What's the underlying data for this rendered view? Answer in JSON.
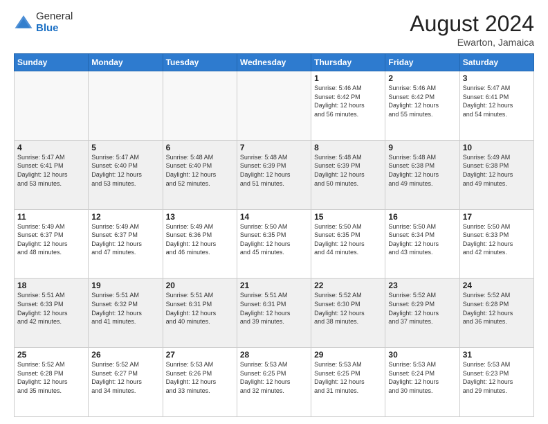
{
  "header": {
    "logo": {
      "general": "General",
      "blue": "Blue"
    },
    "month": "August 2024",
    "location": "Ewarton, Jamaica"
  },
  "weekdays": [
    "Sunday",
    "Monday",
    "Tuesday",
    "Wednesday",
    "Thursday",
    "Friday",
    "Saturday"
  ],
  "weeks": [
    [
      {
        "day": "",
        "info": ""
      },
      {
        "day": "",
        "info": ""
      },
      {
        "day": "",
        "info": ""
      },
      {
        "day": "",
        "info": ""
      },
      {
        "day": "1",
        "info": "Sunrise: 5:46 AM\nSunset: 6:42 PM\nDaylight: 12 hours\nand 56 minutes."
      },
      {
        "day": "2",
        "info": "Sunrise: 5:46 AM\nSunset: 6:42 PM\nDaylight: 12 hours\nand 55 minutes."
      },
      {
        "day": "3",
        "info": "Sunrise: 5:47 AM\nSunset: 6:41 PM\nDaylight: 12 hours\nand 54 minutes."
      }
    ],
    [
      {
        "day": "4",
        "info": "Sunrise: 5:47 AM\nSunset: 6:41 PM\nDaylight: 12 hours\nand 53 minutes."
      },
      {
        "day": "5",
        "info": "Sunrise: 5:47 AM\nSunset: 6:40 PM\nDaylight: 12 hours\nand 53 minutes."
      },
      {
        "day": "6",
        "info": "Sunrise: 5:48 AM\nSunset: 6:40 PM\nDaylight: 12 hours\nand 52 minutes."
      },
      {
        "day": "7",
        "info": "Sunrise: 5:48 AM\nSunset: 6:39 PM\nDaylight: 12 hours\nand 51 minutes."
      },
      {
        "day": "8",
        "info": "Sunrise: 5:48 AM\nSunset: 6:39 PM\nDaylight: 12 hours\nand 50 minutes."
      },
      {
        "day": "9",
        "info": "Sunrise: 5:48 AM\nSunset: 6:38 PM\nDaylight: 12 hours\nand 49 minutes."
      },
      {
        "day": "10",
        "info": "Sunrise: 5:49 AM\nSunset: 6:38 PM\nDaylight: 12 hours\nand 49 minutes."
      }
    ],
    [
      {
        "day": "11",
        "info": "Sunrise: 5:49 AM\nSunset: 6:37 PM\nDaylight: 12 hours\nand 48 minutes."
      },
      {
        "day": "12",
        "info": "Sunrise: 5:49 AM\nSunset: 6:37 PM\nDaylight: 12 hours\nand 47 minutes."
      },
      {
        "day": "13",
        "info": "Sunrise: 5:49 AM\nSunset: 6:36 PM\nDaylight: 12 hours\nand 46 minutes."
      },
      {
        "day": "14",
        "info": "Sunrise: 5:50 AM\nSunset: 6:35 PM\nDaylight: 12 hours\nand 45 minutes."
      },
      {
        "day": "15",
        "info": "Sunrise: 5:50 AM\nSunset: 6:35 PM\nDaylight: 12 hours\nand 44 minutes."
      },
      {
        "day": "16",
        "info": "Sunrise: 5:50 AM\nSunset: 6:34 PM\nDaylight: 12 hours\nand 43 minutes."
      },
      {
        "day": "17",
        "info": "Sunrise: 5:50 AM\nSunset: 6:33 PM\nDaylight: 12 hours\nand 42 minutes."
      }
    ],
    [
      {
        "day": "18",
        "info": "Sunrise: 5:51 AM\nSunset: 6:33 PM\nDaylight: 12 hours\nand 42 minutes."
      },
      {
        "day": "19",
        "info": "Sunrise: 5:51 AM\nSunset: 6:32 PM\nDaylight: 12 hours\nand 41 minutes."
      },
      {
        "day": "20",
        "info": "Sunrise: 5:51 AM\nSunset: 6:31 PM\nDaylight: 12 hours\nand 40 minutes."
      },
      {
        "day": "21",
        "info": "Sunrise: 5:51 AM\nSunset: 6:31 PM\nDaylight: 12 hours\nand 39 minutes."
      },
      {
        "day": "22",
        "info": "Sunrise: 5:52 AM\nSunset: 6:30 PM\nDaylight: 12 hours\nand 38 minutes."
      },
      {
        "day": "23",
        "info": "Sunrise: 5:52 AM\nSunset: 6:29 PM\nDaylight: 12 hours\nand 37 minutes."
      },
      {
        "day": "24",
        "info": "Sunrise: 5:52 AM\nSunset: 6:28 PM\nDaylight: 12 hours\nand 36 minutes."
      }
    ],
    [
      {
        "day": "25",
        "info": "Sunrise: 5:52 AM\nSunset: 6:28 PM\nDaylight: 12 hours\nand 35 minutes."
      },
      {
        "day": "26",
        "info": "Sunrise: 5:52 AM\nSunset: 6:27 PM\nDaylight: 12 hours\nand 34 minutes."
      },
      {
        "day": "27",
        "info": "Sunrise: 5:53 AM\nSunset: 6:26 PM\nDaylight: 12 hours\nand 33 minutes."
      },
      {
        "day": "28",
        "info": "Sunrise: 5:53 AM\nSunset: 6:25 PM\nDaylight: 12 hours\nand 32 minutes."
      },
      {
        "day": "29",
        "info": "Sunrise: 5:53 AM\nSunset: 6:25 PM\nDaylight: 12 hours\nand 31 minutes."
      },
      {
        "day": "30",
        "info": "Sunrise: 5:53 AM\nSunset: 6:24 PM\nDaylight: 12 hours\nand 30 minutes."
      },
      {
        "day": "31",
        "info": "Sunrise: 5:53 AM\nSunset: 6:23 PM\nDaylight: 12 hours\nand 29 minutes."
      }
    ]
  ]
}
